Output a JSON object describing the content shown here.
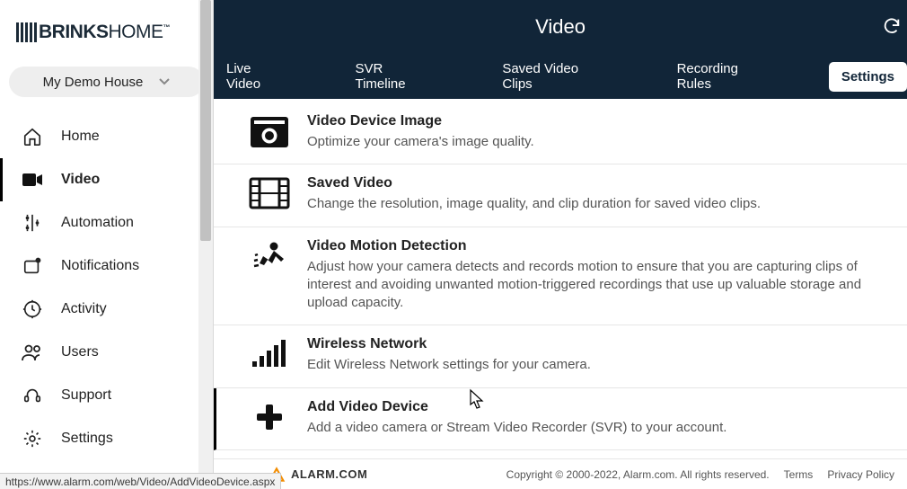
{
  "logo": {
    "brand_bold": "BRINKS",
    "brand_light": "HOME",
    "tm": "™"
  },
  "location": {
    "name": "My Demo House"
  },
  "sidebar": {
    "items": [
      {
        "label": "Home"
      },
      {
        "label": "Video"
      },
      {
        "label": "Automation"
      },
      {
        "label": "Notifications"
      },
      {
        "label": "Activity"
      },
      {
        "label": "Users"
      },
      {
        "label": "Support"
      },
      {
        "label": "Settings"
      }
    ]
  },
  "header": {
    "title": "Video",
    "tabs": [
      {
        "label": "Live Video"
      },
      {
        "label": "SVR Timeline"
      },
      {
        "label": "Saved Video Clips"
      },
      {
        "label": "Recording Rules"
      },
      {
        "label": "Settings"
      }
    ]
  },
  "settings": [
    {
      "title": "Video Device Image",
      "desc": "Optimize your camera's image quality."
    },
    {
      "title": "Saved Video",
      "desc": "Change the resolution, image quality, and clip duration for saved video clips."
    },
    {
      "title": "Video Motion Detection",
      "desc": "Adjust how your camera detects and records motion to ensure that you are capturing clips of interest and avoiding unwanted motion-triggered recordings that use up valuable storage and upload capacity."
    },
    {
      "title": "Wireless Network",
      "desc": "Edit Wireless Network settings for your camera."
    },
    {
      "title": "Add Video Device",
      "desc": "Add a video camera or Stream Video Recorder (SVR) to your account."
    }
  ],
  "footer": {
    "brand": "ALARM.COM",
    "copyright": "Copyright © 2000-2022, Alarm.com. All rights reserved.",
    "terms": "Terms",
    "privacy": "Privacy Policy"
  },
  "status_url": "https://www.alarm.com/web/Video/AddVideoDevice.aspx"
}
